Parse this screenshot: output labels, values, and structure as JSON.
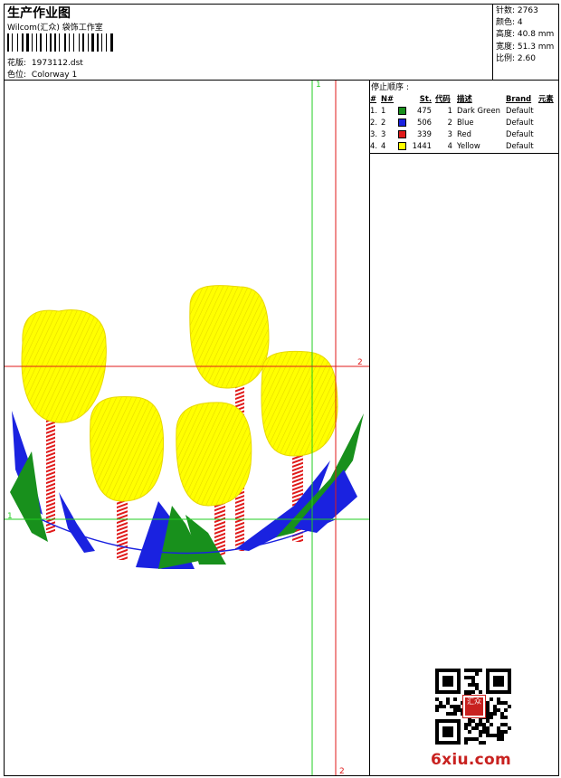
{
  "header": {
    "title": "生产作业图",
    "studio": "Wilcom(汇众) 袋饰工作室",
    "design_label": "花版:",
    "design_file": "1973112.dst",
    "colorway_label": "色位:",
    "colorway": "Colorway 1"
  },
  "stats": {
    "stitches": "针数: 2763",
    "colors": "颜色: 4",
    "height": "高度: 40.8 mm",
    "width": "宽度: 51.3 mm",
    "ratio": "比例: 2.60"
  },
  "stop_sequence": {
    "title": "停止顺序 :",
    "headers": [
      "#",
      "N#",
      "St.",
      "代码",
      "描述",
      "Brand",
      "元素"
    ],
    "rows": [
      {
        "n": "1.",
        "needle": "1",
        "color": "#18901c",
        "stitches": "475",
        "code": "1",
        "desc": "Dark Green",
        "brand": "Default"
      },
      {
        "n": "2.",
        "needle": "2",
        "color": "#1a22e0",
        "stitches": "506",
        "code": "2",
        "desc": "Blue",
        "brand": "Default"
      },
      {
        "n": "3.",
        "needle": "3",
        "color": "#e01a1a",
        "stitches": "339",
        "code": "3",
        "desc": "Red",
        "brand": "Default"
      },
      {
        "n": "4.",
        "needle": "4",
        "color": "#ffff00",
        "stitches": "1441",
        "code": "4",
        "desc": "Yellow",
        "brand": "Default"
      }
    ]
  },
  "guides": {
    "v1": "1",
    "v2": "2",
    "h1": "1",
    "h2": "2",
    "green": "#22cc22",
    "red": "#e01a1a"
  },
  "qr": {
    "seal_text": "汇众"
  },
  "watermark": "6xiu.com"
}
